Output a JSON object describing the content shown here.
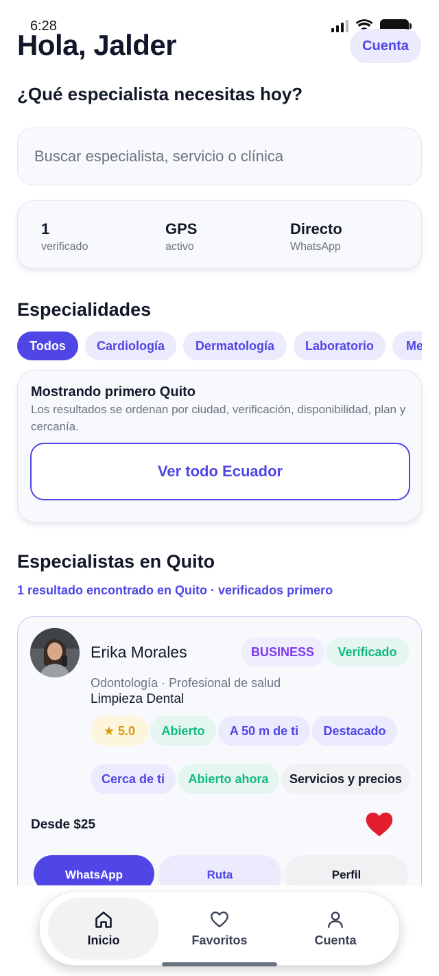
{
  "status_bar": {
    "time": "6:28"
  },
  "header": {
    "greeting": "Hola, Jalder",
    "account_label": "Cuenta"
  },
  "question": "¿Qué especialista necesitas hoy?",
  "search": {
    "placeholder": "Buscar especialista, servicio o clínica",
    "value": ""
  },
  "stats": [
    {
      "value": "1",
      "label": "verificado"
    },
    {
      "value": "GPS",
      "label": "activo"
    },
    {
      "value": "Directo",
      "label": "WhatsApp"
    }
  ],
  "specialties": {
    "title": "Especialidades",
    "chips": [
      "Todos",
      "Cardiología",
      "Dermatología",
      "Laboratorio",
      "Medicina General"
    ],
    "selected": "Todos"
  },
  "location_info": {
    "title": "Mostrando primero Quito",
    "description": "Los resultados se ordenan por ciudad, verificación, disponibilidad, plan y cercanía.",
    "button_label": "Ver todo Ecuador"
  },
  "results": {
    "title": "Especialistas en Quito",
    "subtitle": "1 resultado encontrado en Quito · verificados primero",
    "items": [
      {
        "name": "Erika Morales",
        "plan_badge": "BUSINESS",
        "verified_badge": "Verificado",
        "category": "Odontología · Profesional de salud",
        "service": "Limpieza Dental",
        "rating": "★ 5.0",
        "tags": [
          "Abierto",
          "A 50 m de ti",
          "Destacado"
        ],
        "tags_row2": [
          "Cerca de ti",
          "Abierto ahora",
          "Servicios y precios"
        ],
        "price": "Desde $25",
        "favorite": true,
        "actions": {
          "whatsapp": "WhatsApp",
          "route": "Ruta",
          "profile": "Perfil"
        }
      }
    ]
  },
  "bottom_nav": {
    "items": [
      {
        "label": "Inicio",
        "icon": "home-icon",
        "active": true
      },
      {
        "label": "Favoritos",
        "icon": "heart-outline-icon",
        "active": false
      },
      {
        "label": "Cuenta",
        "icon": "user-icon",
        "active": false
      }
    ]
  },
  "colors": {
    "accent": "#4f46e5",
    "success": "#10b981",
    "favorite": "#e11d2e",
    "rating": "#d99a0b"
  }
}
